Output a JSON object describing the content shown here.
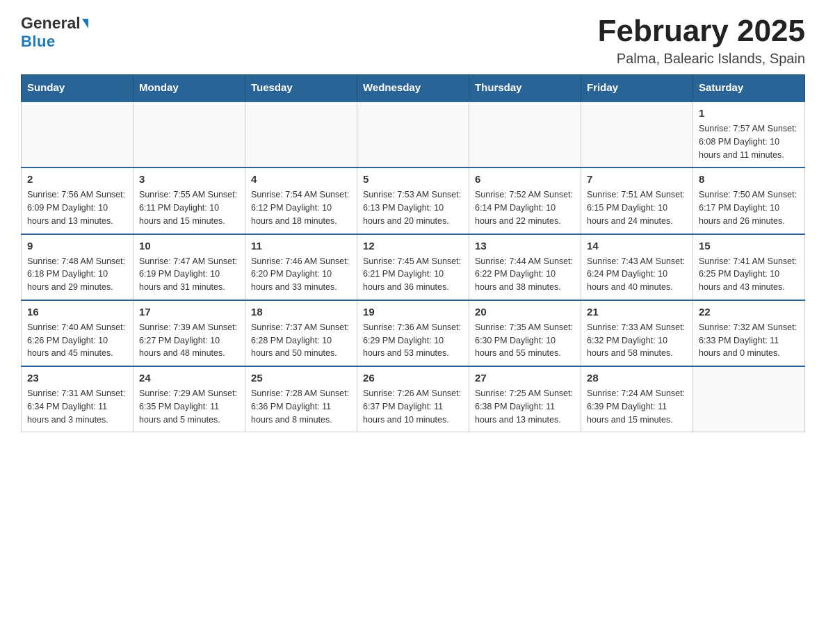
{
  "header": {
    "logo_general": "General",
    "logo_blue": "Blue",
    "title": "February 2025",
    "subtitle": "Palma, Balearic Islands, Spain"
  },
  "calendar": {
    "days_of_week": [
      "Sunday",
      "Monday",
      "Tuesday",
      "Wednesday",
      "Thursday",
      "Friday",
      "Saturday"
    ],
    "weeks": [
      [
        {
          "day": "",
          "info": ""
        },
        {
          "day": "",
          "info": ""
        },
        {
          "day": "",
          "info": ""
        },
        {
          "day": "",
          "info": ""
        },
        {
          "day": "",
          "info": ""
        },
        {
          "day": "",
          "info": ""
        },
        {
          "day": "1",
          "info": "Sunrise: 7:57 AM\nSunset: 6:08 PM\nDaylight: 10 hours and 11 minutes."
        }
      ],
      [
        {
          "day": "2",
          "info": "Sunrise: 7:56 AM\nSunset: 6:09 PM\nDaylight: 10 hours and 13 minutes."
        },
        {
          "day": "3",
          "info": "Sunrise: 7:55 AM\nSunset: 6:11 PM\nDaylight: 10 hours and 15 minutes."
        },
        {
          "day": "4",
          "info": "Sunrise: 7:54 AM\nSunset: 6:12 PM\nDaylight: 10 hours and 18 minutes."
        },
        {
          "day": "5",
          "info": "Sunrise: 7:53 AM\nSunset: 6:13 PM\nDaylight: 10 hours and 20 minutes."
        },
        {
          "day": "6",
          "info": "Sunrise: 7:52 AM\nSunset: 6:14 PM\nDaylight: 10 hours and 22 minutes."
        },
        {
          "day": "7",
          "info": "Sunrise: 7:51 AM\nSunset: 6:15 PM\nDaylight: 10 hours and 24 minutes."
        },
        {
          "day": "8",
          "info": "Sunrise: 7:50 AM\nSunset: 6:17 PM\nDaylight: 10 hours and 26 minutes."
        }
      ],
      [
        {
          "day": "9",
          "info": "Sunrise: 7:48 AM\nSunset: 6:18 PM\nDaylight: 10 hours and 29 minutes."
        },
        {
          "day": "10",
          "info": "Sunrise: 7:47 AM\nSunset: 6:19 PM\nDaylight: 10 hours and 31 minutes."
        },
        {
          "day": "11",
          "info": "Sunrise: 7:46 AM\nSunset: 6:20 PM\nDaylight: 10 hours and 33 minutes."
        },
        {
          "day": "12",
          "info": "Sunrise: 7:45 AM\nSunset: 6:21 PM\nDaylight: 10 hours and 36 minutes."
        },
        {
          "day": "13",
          "info": "Sunrise: 7:44 AM\nSunset: 6:22 PM\nDaylight: 10 hours and 38 minutes."
        },
        {
          "day": "14",
          "info": "Sunrise: 7:43 AM\nSunset: 6:24 PM\nDaylight: 10 hours and 40 minutes."
        },
        {
          "day": "15",
          "info": "Sunrise: 7:41 AM\nSunset: 6:25 PM\nDaylight: 10 hours and 43 minutes."
        }
      ],
      [
        {
          "day": "16",
          "info": "Sunrise: 7:40 AM\nSunset: 6:26 PM\nDaylight: 10 hours and 45 minutes."
        },
        {
          "day": "17",
          "info": "Sunrise: 7:39 AM\nSunset: 6:27 PM\nDaylight: 10 hours and 48 minutes."
        },
        {
          "day": "18",
          "info": "Sunrise: 7:37 AM\nSunset: 6:28 PM\nDaylight: 10 hours and 50 minutes."
        },
        {
          "day": "19",
          "info": "Sunrise: 7:36 AM\nSunset: 6:29 PM\nDaylight: 10 hours and 53 minutes."
        },
        {
          "day": "20",
          "info": "Sunrise: 7:35 AM\nSunset: 6:30 PM\nDaylight: 10 hours and 55 minutes."
        },
        {
          "day": "21",
          "info": "Sunrise: 7:33 AM\nSunset: 6:32 PM\nDaylight: 10 hours and 58 minutes."
        },
        {
          "day": "22",
          "info": "Sunrise: 7:32 AM\nSunset: 6:33 PM\nDaylight: 11 hours and 0 minutes."
        }
      ],
      [
        {
          "day": "23",
          "info": "Sunrise: 7:31 AM\nSunset: 6:34 PM\nDaylight: 11 hours and 3 minutes."
        },
        {
          "day": "24",
          "info": "Sunrise: 7:29 AM\nSunset: 6:35 PM\nDaylight: 11 hours and 5 minutes."
        },
        {
          "day": "25",
          "info": "Sunrise: 7:28 AM\nSunset: 6:36 PM\nDaylight: 11 hours and 8 minutes."
        },
        {
          "day": "26",
          "info": "Sunrise: 7:26 AM\nSunset: 6:37 PM\nDaylight: 11 hours and 10 minutes."
        },
        {
          "day": "27",
          "info": "Sunrise: 7:25 AM\nSunset: 6:38 PM\nDaylight: 11 hours and 13 minutes."
        },
        {
          "day": "28",
          "info": "Sunrise: 7:24 AM\nSunset: 6:39 PM\nDaylight: 11 hours and 15 minutes."
        },
        {
          "day": "",
          "info": ""
        }
      ]
    ]
  }
}
